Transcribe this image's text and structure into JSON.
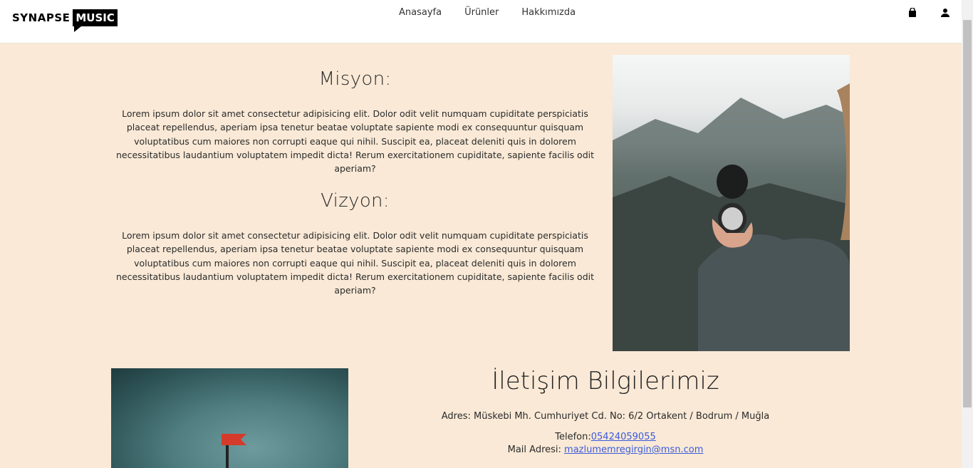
{
  "brand": {
    "name_part1": "SYNAPSE",
    "name_part2": "MUSIC"
  },
  "nav": {
    "links": [
      "Anasayfa",
      "Ürünler",
      "Hakkımızda"
    ],
    "icons": [
      "shopping-bag-icon",
      "user-icon"
    ]
  },
  "about": {
    "mission_title": "Misyon:",
    "mission_text": "Lorem ipsum dolor sit amet consectetur adipisicing elit. Dolor odit velit numquam cupiditate perspiciatis placeat repellendus, aperiam ipsa tenetur beatae voluptate sapiente modi ex consequuntur quisquam voluptatibus cum maiores non corrupti eaque qui nihil. Suscipit ea, placeat deleniti quis in dolorem necessitatibus laudantium voluptatem impedit dicta! Rerum exercitationem cupiditate, sapiente facilis odit aperiam?",
    "vision_title": "Vizyon:",
    "vision_text": "Lorem ipsum dolor sit amet consectetur adipisicing elit. Dolor odit velit numquam cupiditate perspiciatis placeat repellendus, aperiam ipsa tenetur beatae voluptate sapiente modi ex consequuntur quisquam voluptatibus cum maiores non corrupti eaque qui nihil. Suscipit ea, placeat deleniti quis in dolorem necessitatibus laudantium voluptatem impedit dicta! Rerum exercitationem cupiditate, sapiente facilis odit aperiam?"
  },
  "contact": {
    "title": "İletişim Bilgilerimiz",
    "address_label": "Adres:",
    "address_value": "Müskebi Mh. Cumhuriyet Cd. No: 6/2 Ortakent / Bodrum / Muğla",
    "phone_label": "Telefon:",
    "phone_value": "05424059055",
    "mail_label": "Mail Adresi:",
    "mail_value": "mazlumemregirgin@msn.com"
  },
  "colors": {
    "background": "#f9e9d6",
    "navbar": "#ffffff",
    "link": "#3b5bdb"
  }
}
